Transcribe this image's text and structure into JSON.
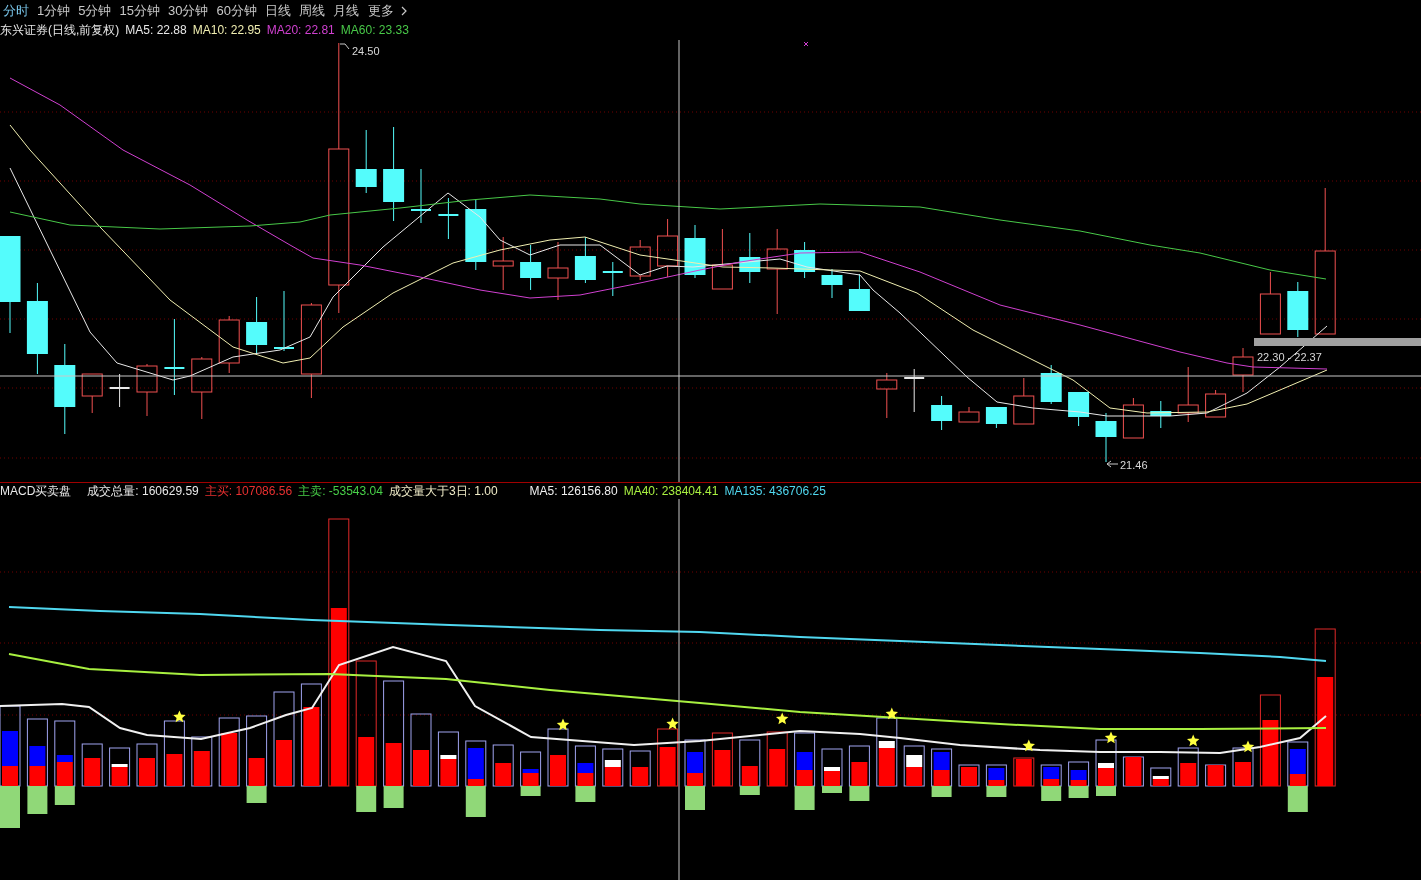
{
  "toolbar": {
    "periods": [
      {
        "label": "分时",
        "selected": true
      },
      {
        "label": "1分钟",
        "selected": false
      },
      {
        "label": "5分钟",
        "selected": false
      },
      {
        "label": "15分钟",
        "selected": false
      },
      {
        "label": "30分钟",
        "selected": false
      },
      {
        "label": "60分钟",
        "selected": false
      },
      {
        "label": "日线",
        "selected": false
      },
      {
        "label": "周线",
        "selected": false
      },
      {
        "label": "月线",
        "selected": false
      }
    ],
    "more": "更多"
  },
  "price_panel": {
    "title": "东兴证券(日线,前复权)",
    "moving_averages": [
      {
        "text": "MA5: 22.88",
        "color": "#e8e8e8"
      },
      {
        "text": "MA10: 22.95",
        "color": "#f0eeb0"
      },
      {
        "text": "MA20: 22.81",
        "color": "#d040d0"
      },
      {
        "text": "MA60: 23.33",
        "color": "#48c848"
      }
    ],
    "high_label": "24.50",
    "low_label": "21.46",
    "range_label": "22.30 - 22.37"
  },
  "indicator_panel": {
    "title": "MACD买卖盘",
    "values": [
      {
        "text": "成交总量: 160629.59",
        "color": "#e8e8e8"
      },
      {
        "text": "主买: 107086.56",
        "color": "#e83030"
      },
      {
        "text": "主卖: -53543.04",
        "color": "#48d048"
      },
      {
        "text": "成交量大于3日: 1.00",
        "color": "#f0ecc8"
      }
    ],
    "moving_averages": [
      {
        "text": "MA5: 126156.80",
        "color": "#f0f0f0"
      },
      {
        "text": "MA40: 238404.41",
        "color": "#a8f040"
      },
      {
        "text": "MA135: 436706.25",
        "color": "#50d8f0"
      }
    ]
  }
}
